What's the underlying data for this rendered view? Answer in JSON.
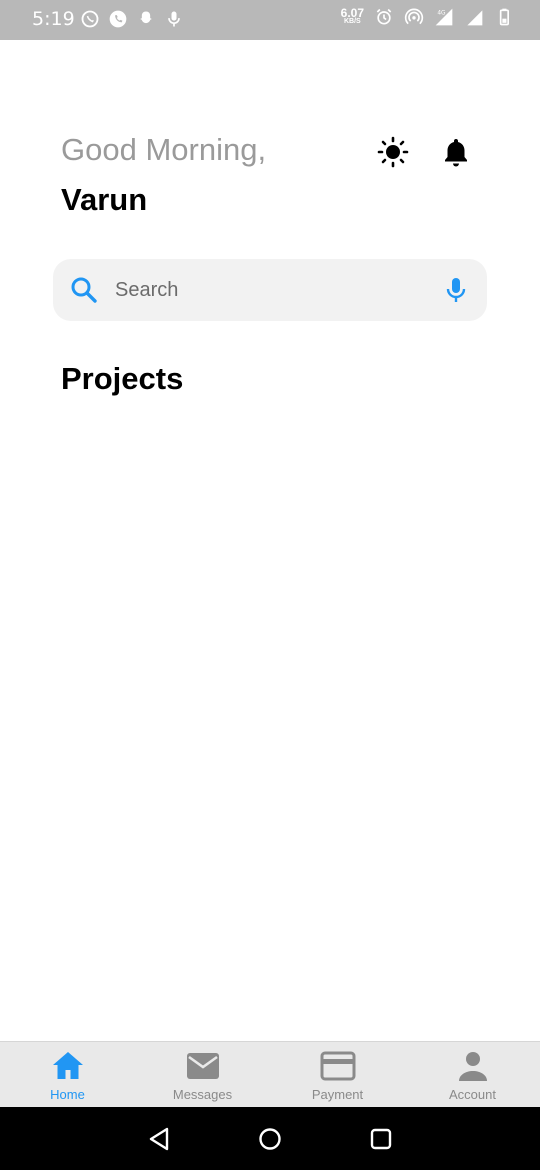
{
  "status_bar": {
    "time": "5:19",
    "net_speed_value": "6.07",
    "net_speed_unit": "KB/S",
    "left_icons": [
      "whatsapp-icon",
      "phone-icon",
      "snapchat-icon",
      "microphone-icon"
    ],
    "right_icons": [
      "alarm-icon",
      "hotspot-icon",
      "signal-4g-icon",
      "signal-icon",
      "battery-icon"
    ]
  },
  "header": {
    "greeting": "Good Morning,",
    "user_name": "Varun",
    "theme_icon": "sun-icon",
    "notification_icon": "bell-icon"
  },
  "search": {
    "placeholder": "Search",
    "value": ""
  },
  "projects": {
    "title": "Projects"
  },
  "bottom_nav": {
    "items": [
      {
        "label": "Home",
        "icon": "home-icon",
        "active": true
      },
      {
        "label": "Messages",
        "icon": "mail-icon",
        "active": false
      },
      {
        "label": "Payment",
        "icon": "credit-card-icon",
        "active": false
      },
      {
        "label": "Account",
        "icon": "person-icon",
        "active": false
      }
    ]
  },
  "colors": {
    "accent": "#2196f3",
    "inactive_icon": "#8a8a8a",
    "greeting_text": "#9a9a9a",
    "search_bg": "#f2f2f2",
    "nav_bg": "#e9e9e9"
  }
}
